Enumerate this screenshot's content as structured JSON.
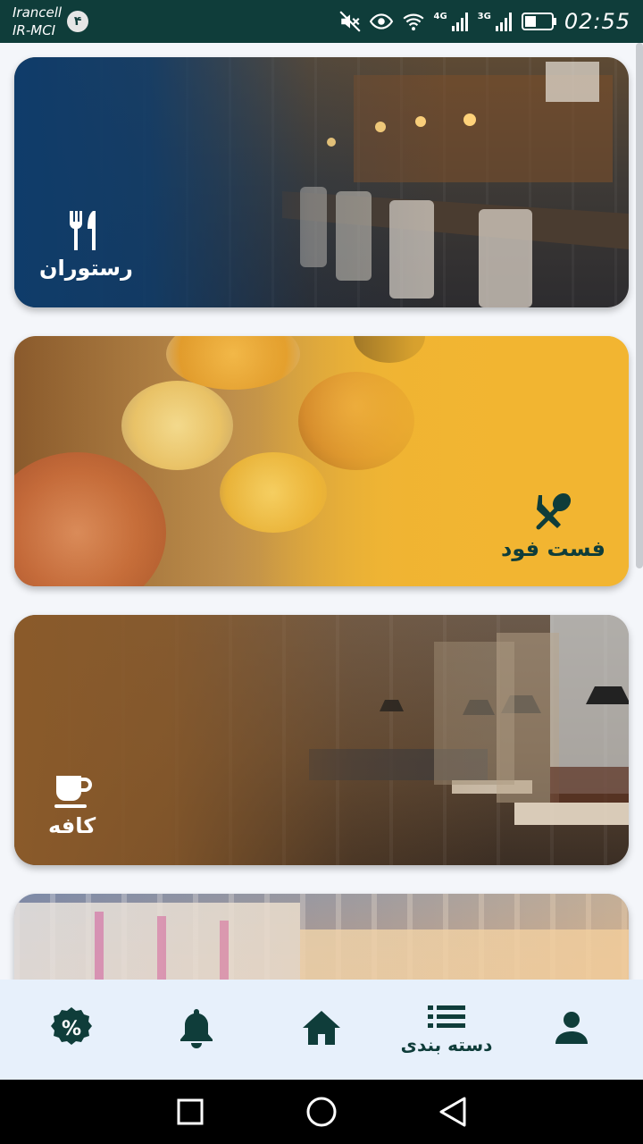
{
  "status_bar": {
    "carrier_line1": "Irancell",
    "carrier_line2": "IR-MCI",
    "sim_badge": "۴",
    "network_4g": "4G",
    "network_3g": "3G",
    "time": "02:55",
    "icons": [
      "mute-icon",
      "eye-icon",
      "wifi-icon",
      "signal-4g-icon",
      "signal-3g-icon",
      "battery-icon"
    ]
  },
  "categories": [
    {
      "title": "رستوران",
      "icon": "fork-knife-icon"
    },
    {
      "title": "فست فود",
      "icon": "crossed-utensils-icon"
    },
    {
      "title": "کافه",
      "icon": "coffee-cup-icon"
    },
    {
      "title": "",
      "icon": ""
    }
  ],
  "bottom_nav": {
    "items": [
      {
        "key": "profile",
        "icon": "person-icon",
        "label": ""
      },
      {
        "key": "categories",
        "icon": "list-icon",
        "label": "دسته بندی"
      },
      {
        "key": "home",
        "icon": "home-icon",
        "label": ""
      },
      {
        "key": "notifications",
        "icon": "bell-icon",
        "label": ""
      },
      {
        "key": "discounts",
        "icon": "percent-badge-icon",
        "label": ""
      }
    ]
  },
  "colors": {
    "primary": "#0f3d3a",
    "nav_background": "#e7f0fb",
    "restaurant_overlay": "#0f3c6a",
    "fastfood_overlay": "#f2b531",
    "cafe_overlay": "#8a5a2a"
  }
}
